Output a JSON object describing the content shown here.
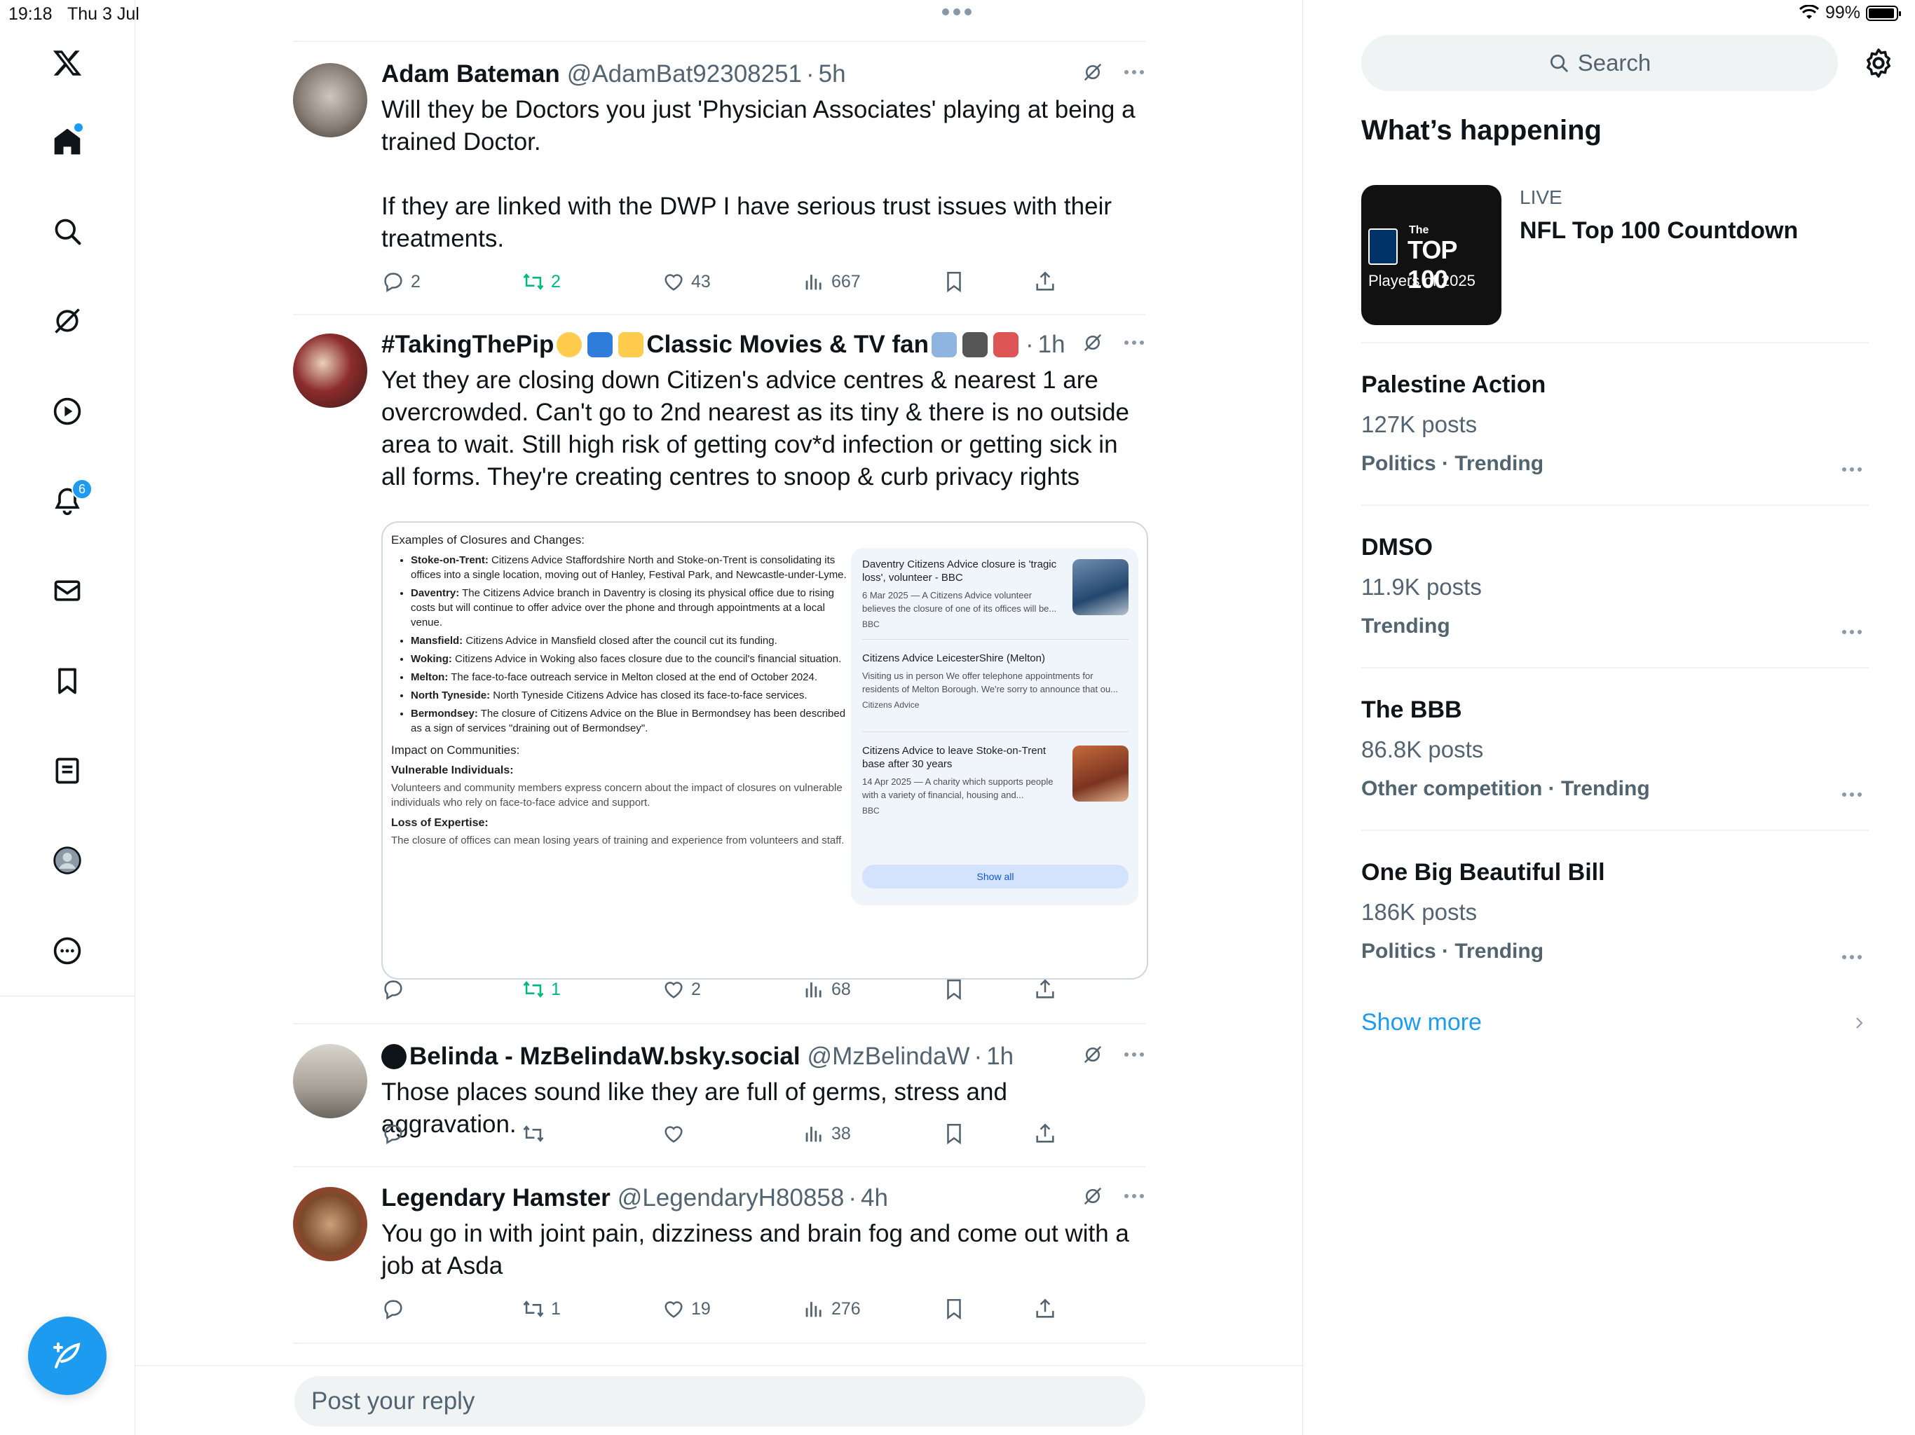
{
  "status": {
    "time": "19:18",
    "date": "Thu 3 Jul",
    "battery": "99%"
  },
  "nav": {
    "notifications_badge": "6"
  },
  "tweets": [
    {
      "name": "Adam Bateman",
      "handle": "@AdamBat92308251",
      "time": "5h",
      "text": "Will they be Doctors you just 'Physician Associates' playing at being a trained Doctor.\n\nIf they are linked with the DWP I have serious trust issues with their treatments.",
      "replies": "2",
      "retweets": "2",
      "likes": "43",
      "views": "667"
    },
    {
      "name_a": "#TakingThePip",
      "name_b": "Classic Movies & TV fan",
      "time": "1h",
      "text": "Yet they are closing down Citizen's advice centres & nearest 1 are overcrowded. Can't go to 2nd nearest as its tiny & there is no outside area to wait. Still high risk of getting cov*d infection or getting sick in all forms. They're creating centres to snoop & curb privacy rights",
      "replies": "",
      "retweets": "1",
      "likes": "2",
      "views": "68",
      "embed": {
        "heading": "Examples of Closures and Changes:",
        "items": [
          {
            "b": "Stoke-on-Trent:",
            "t": " Citizens Advice Staffordshire North and Stoke-on-Trent is consolidating its offices into a single location, moving out of Hanley, Festival Park, and Newcastle-under-Lyme."
          },
          {
            "b": "Daventry:",
            "t": " The Citizens Advice branch in Daventry is closing its physical office due to rising costs but will continue to offer advice over the phone and through appointments at a local venue."
          },
          {
            "b": "Mansfield:",
            "t": " Citizens Advice in Mansfield closed after the council cut its funding."
          },
          {
            "b": "Woking:",
            "t": " Citizens Advice in Woking also faces closure due to the council's financial situation."
          },
          {
            "b": "Melton:",
            "t": " The face-to-face outreach service in Melton closed at the end of October 2024."
          },
          {
            "b": "North Tyneside:",
            "t": " North Tyneside Citizens Advice has closed its face-to-face services."
          },
          {
            "b": "Bermondsey:",
            "t": " The closure of Citizens Advice on the Blue in Bermondsey has been described as a sign of services \"draining out of Bermondsey\"."
          }
        ],
        "impact": "Impact on Communities:",
        "vuln_h": "Vulnerable Individuals:",
        "vuln_t": "Volunteers and community members express concern about the impact of closures on vulnerable individuals who rely on face-to-face advice and support.",
        "loss_h": "Loss of Expertise:",
        "loss_t": "The closure of offices can mean losing years of training and experience from volunteers and staff.",
        "cards": [
          {
            "title": "Daventry Citizens Advice closure is 'tragic loss', volunteer - BBC",
            "meta": "6 Mar 2025 — A Citizens Advice volunteer believes the closure of one of its offices will be...",
            "src": "BBC"
          },
          {
            "title": "Citizens Advice LeicesterShire (Melton)",
            "meta": "Visiting us in person We offer telephone appointments for residents of Melton Borough. We're sorry to announce that ou...",
            "src": "Citizens Advice"
          },
          {
            "title": "Citizens Advice to leave Stoke-on-Trent base after 30 years",
            "meta": "14 Apr 2025 — A charity which supports people with a variety of financial, housing and...",
            "src": "BBC"
          }
        ],
        "show_all": "Show all"
      }
    },
    {
      "name": "Belinda - MzBelindaW.bsky.social",
      "handle": "@MzBelindaW",
      "time": "1h",
      "text": "Those places sound like they are full of germs, stress and aggravation.",
      "replies": "",
      "retweets": "",
      "likes": "",
      "views": "38"
    },
    {
      "name": "Legendary Hamster",
      "handle": "@LegendaryH80858",
      "time": "4h",
      "text": "You go in with joint pain, dizziness and brain fog and come out with a job at Asda",
      "replies": "",
      "retweets": "1",
      "likes": "19",
      "views": "276"
    }
  ],
  "reply_placeholder": "Post your reply",
  "sidebar": {
    "search": "Search",
    "title": "What’s happening",
    "live": {
      "label": "LIVE",
      "title": "NFL Top 100 Countdown",
      "thumb_line1": "The",
      "thumb_line2": "TOP 100",
      "thumb_line3": "Players of 2025"
    },
    "trends": [
      {
        "name": "Palestine Action",
        "count": "127K posts",
        "meta": "Politics · Trending"
      },
      {
        "name": "DMSO",
        "count": "11.9K posts",
        "meta": "Trending"
      },
      {
        "name": "The BBB",
        "count": "86.8K posts",
        "meta": "Other competition · Trending"
      },
      {
        "name": "One Big Beautiful Bill",
        "count": "186K posts",
        "meta": "Politics · Trending"
      }
    ],
    "show_more": "Show more"
  },
  "icons": [
    "x-logo-icon",
    "home-icon",
    "search-icon",
    "grok-icon",
    "video-icon",
    "bell-icon",
    "mail-icon",
    "bookmark-icon",
    "list-icon",
    "profile-icon",
    "more-icon",
    "compose-icon",
    "reply-icon",
    "retweet-icon",
    "like-icon",
    "views-icon",
    "share-icon",
    "gear-icon"
  ],
  "colors": {
    "accent": "#1d9bf0",
    "retweet": "#00ba7c",
    "muted": "#536471"
  }
}
